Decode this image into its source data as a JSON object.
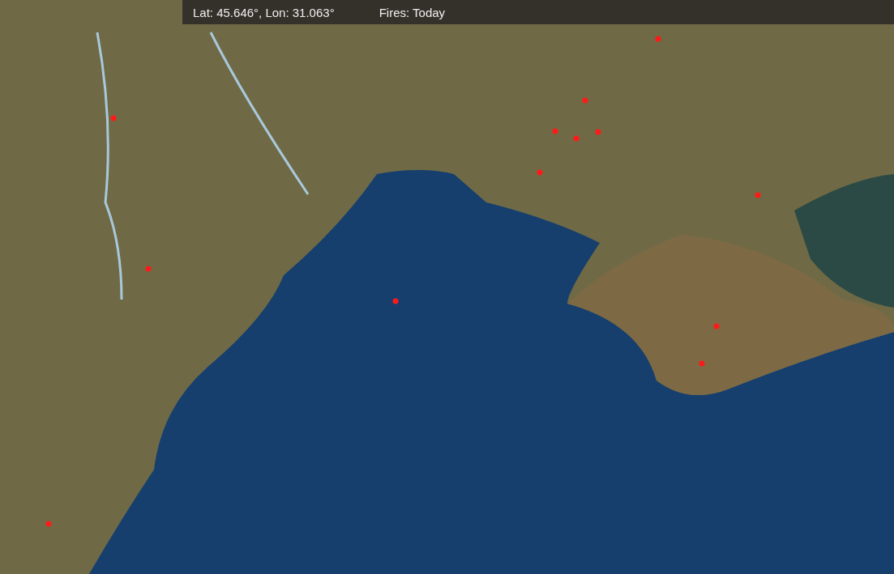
{
  "status_bar": {
    "coordinates": "Lat: 45.646°, Lon: 31.063°",
    "fires": "Fires: Today"
  }
}
